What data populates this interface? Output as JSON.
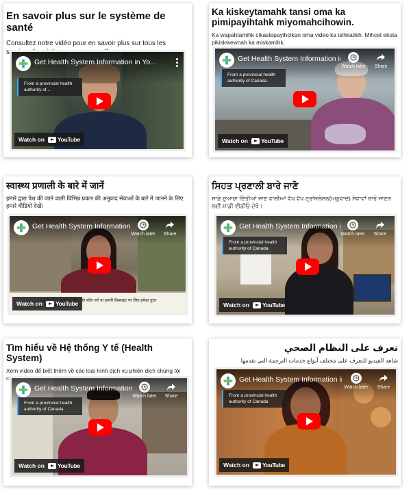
{
  "cards": [
    {
      "title": "En savoir plus sur le système de santé",
      "description": "Consultez notre vidéo pour en savoir plus sur tous les services linguistiques que nous offrons.",
      "video": {
        "title": "Get Health System Information in Yo...",
        "info": "From a provincial health authority of...",
        "watch_label": "Watch on",
        "youtube_label": "YouTube"
      }
    },
    {
      "title": "Ka kiskeytamahk tansi oma ka pimipayihtahk miyomahcihowin.",
      "description": "Ka wapahtamihk cikastepayihcikan oma video ka isihkatikh. Mihcet ekota pikiskwewnah ka miskamihk.",
      "video": {
        "title": "Get Health System Information in Yo...",
        "info": "From a provincial health authority of Canada",
        "watch_later": "Watch later",
        "share": "Share",
        "watch_label": "Watch on",
        "youtube_label": "YouTube"
      }
    },
    {
      "title": "स्वास्थ्य प्रणाली के बारे में जानें",
      "description": "हमारे द्वारा पेश की जाने वाली विभिन्न प्रकार की अनुवाद सेवाओं के बारे में जानने के लिए हमारे वीडियो देखें।",
      "video": {
        "title": "Get Health System Information in Yo...",
        "watch_later": "Watch later",
        "share": "Share",
        "watch_label": "Watch on",
        "youtube_label": "YouTube",
        "caption": "र ज़्यों हैं। 811 पर हैल्थ लिंक को कॉल करें या हमारी वैबसाइट पर लिए हमेशा तुरंत 911 पर कॉल करना याद रखें।"
      }
    },
    {
      "title": "ਸਿਹਤ ਪ੍ਰਣਾਲੀ ਬਾਰੇ ਜਾਣੋ",
      "description": "ਸਾਡੇ ਦੁਆਰਾ ਦਿੱਤੀਆਂ ਜਾਣ ਵਾਲੀਆਂ ਵੱਖ ਵੱਖ ਟ੍ਰਾਂਸਲੇਸ਼ਨ(ਅਨੁਵਾਦ) ਸੇਵਾਵਾਂ ਬਾਰੇ ਜਾਣਨ ਲਈ ਸਾਡੀ ਵੀਡੀਓ ਦੇਖੋ।",
      "video": {
        "title": "Get Health System Information in Yo...",
        "info": "From a provincial health authority of Canada",
        "watch_later": "Watch later",
        "share": "Share",
        "watch_label": "Watch on",
        "youtube_label": "YouTube"
      }
    },
    {
      "title": "Tìm hiểu về Hệ thống Y tế (Health System)",
      "description": "Xem video để biết thêm về các loại hình dịch vụ phiên dịch chúng tôi cung cấp",
      "video": {
        "title": "Get Health System Information in Yo...",
        "info": "From a provincial health authority of Canada",
        "watch_later": "Watch later",
        "share": "Share",
        "watch_label": "Watch on",
        "youtube_label": "YouTube"
      }
    },
    {
      "title": "تعرف على النظام الصحي",
      "description": "شاهد الفيديو للتعرف على مختلف أنواع خدمات الترجمة التي نقدمها.",
      "video": {
        "title": "Get Health System Information in Yo...",
        "info": "From a provincial health authority of Canada",
        "watch_later": "Watch later",
        "share": "Share",
        "watch_label": "Watch on",
        "youtube_label": "YouTube"
      }
    }
  ],
  "colors": {
    "play_button": "#ff0000",
    "info_accent": "#3ea6ff",
    "card_bg": "#ffffff"
  },
  "icons": {
    "channel": "health-services-logo-icon",
    "watch_later": "clock-icon",
    "share": "share-arrow-icon",
    "more": "more-vertical-icon"
  }
}
